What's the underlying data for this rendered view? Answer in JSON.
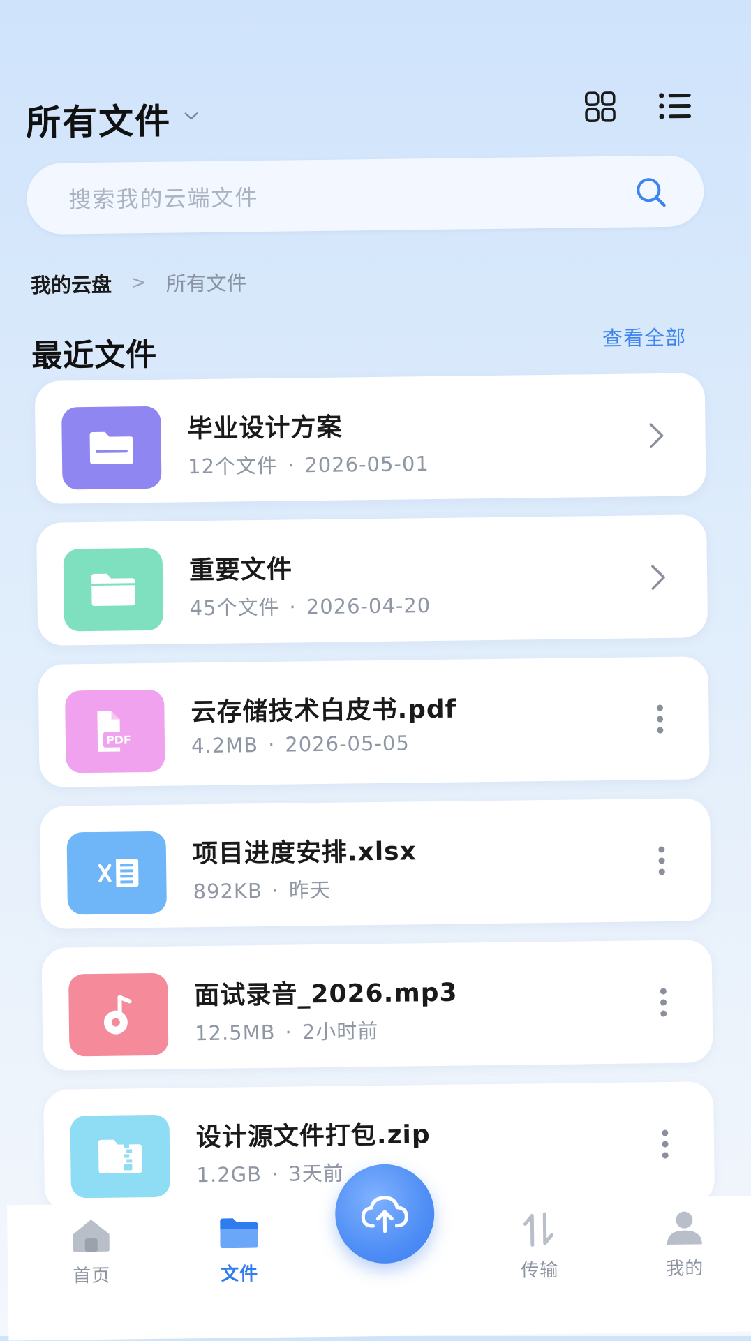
{
  "header": {
    "title": "所有文件",
    "icons": [
      "chevron-down-icon",
      "grid-view-icon",
      "list-view-icon"
    ]
  },
  "search": {
    "placeholder": "搜索我的云端文件"
  },
  "breadcrumb": {
    "root": "我的云盘",
    "separator": ">",
    "current": "所有文件"
  },
  "recent": {
    "title": "最近文件",
    "view_all": "查看全部",
    "items": [
      {
        "name": "毕业设计方案",
        "size": "12个文件",
        "date": "2026-05-01",
        "type": "folder",
        "color": "#8f86f1",
        "action": "chevron-right-icon"
      },
      {
        "name": "重要文件",
        "size": "45个文件",
        "date": "2026-04-20",
        "type": "folder",
        "color": "#7fe0c0",
        "action": "chevron-right-icon"
      },
      {
        "name": "云存储技术白皮书.pdf",
        "size": "4.2MB",
        "date": "2026-05-05",
        "type": "pdf",
        "color": "#f0a2ee",
        "action": "more-icon"
      },
      {
        "name": "项目进度安排.xlsx",
        "size": "892KB",
        "date": "昨天",
        "type": "excel",
        "color": "#6fb6f8",
        "action": "more-icon"
      },
      {
        "name": "面试录音_2026.mp3",
        "size": "12.5MB",
        "date": "2小时前",
        "type": "audio",
        "color": "#f58b9a",
        "action": "more-icon"
      },
      {
        "name": "设计源文件打包.zip",
        "size": "1.2GB",
        "date": "3天前",
        "type": "zip",
        "color": "#8fdcf5",
        "action": "more-icon"
      }
    ]
  },
  "nav": {
    "items": [
      {
        "label": "首页",
        "icon": "home-icon",
        "active": false
      },
      {
        "label": "文件",
        "icon": "folder-icon",
        "active": true
      },
      {
        "label": "传输",
        "icon": "transfer-icon",
        "active": false
      },
      {
        "label": "我的",
        "icon": "profile-icon",
        "active": false
      }
    ],
    "fab_icon": "cloud-upload-icon"
  },
  "colors": {
    "accent": "#2f7cf0",
    "link": "#3d84ee"
  }
}
